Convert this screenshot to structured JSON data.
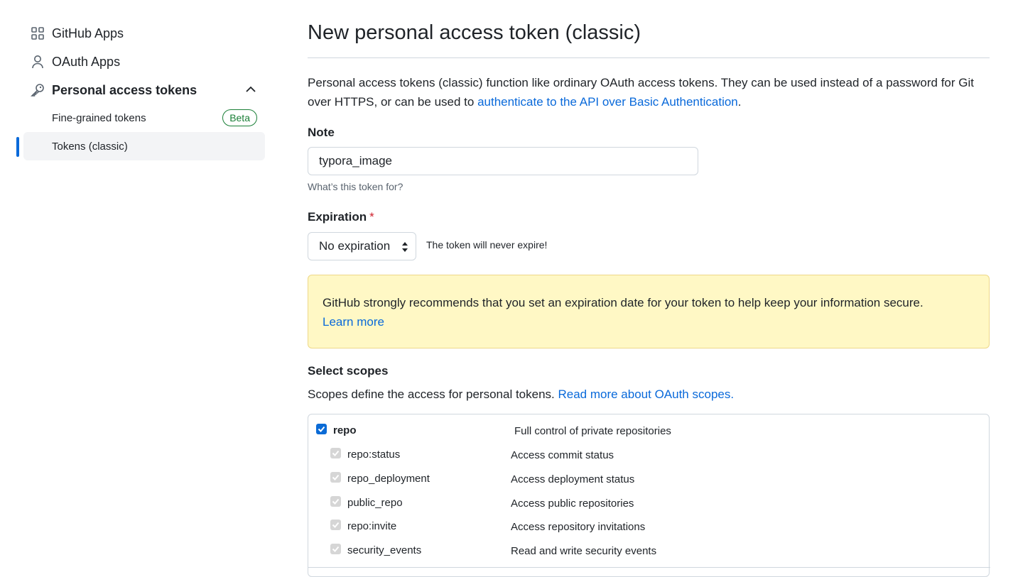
{
  "sidebar": {
    "items": [
      {
        "label": "GitHub Apps",
        "icon": "apps-grid-icon"
      },
      {
        "label": "OAuth Apps",
        "icon": "person-icon"
      },
      {
        "label": "Personal access tokens",
        "icon": "key-icon"
      }
    ],
    "sub_items": [
      {
        "label": "Fine-grained tokens",
        "badge": "Beta"
      },
      {
        "label": "Tokens (classic)"
      }
    ]
  },
  "main": {
    "title": "New personal access token (classic)",
    "intro_text": "Personal access tokens (classic) function like ordinary OAuth access tokens. They can be used instead of a password for Git over HTTPS, or can be used to ",
    "intro_link": "authenticate to the API over Basic Authentication",
    "intro_end": ".",
    "note": {
      "label": "Note",
      "value": "typora_image",
      "hint": "What’s this token for?"
    },
    "expiration": {
      "label": "Expiration",
      "required_mark": "*",
      "selected": "No expiration",
      "note": "The token will never expire!"
    },
    "warning": {
      "text": "GitHub strongly recommends that you set an expiration date for your token to help keep your information secure.",
      "link": "Learn more"
    },
    "scopes": {
      "heading": "Select scopes",
      "desc_text": "Scopes define the access for personal tokens. ",
      "desc_link": "Read more about OAuth scopes.",
      "items": [
        {
          "name": "repo",
          "desc": "Full control of private repositories",
          "checked": true,
          "parent": true
        },
        {
          "name": "repo:status",
          "desc": "Access commit status",
          "checked": true
        },
        {
          "name": "repo_deployment",
          "desc": "Access deployment status",
          "checked": true
        },
        {
          "name": "public_repo",
          "desc": "Access public repositories",
          "checked": true
        },
        {
          "name": "repo:invite",
          "desc": "Access repository invitations",
          "checked": true
        },
        {
          "name": "security_events",
          "desc": "Read and write security events",
          "checked": true
        }
      ]
    }
  },
  "colors": {
    "link": "#0969da",
    "beta": "#1a7f37",
    "warning_bg": "#fff8c5",
    "checkbox_checked": "#0b6bd6"
  }
}
